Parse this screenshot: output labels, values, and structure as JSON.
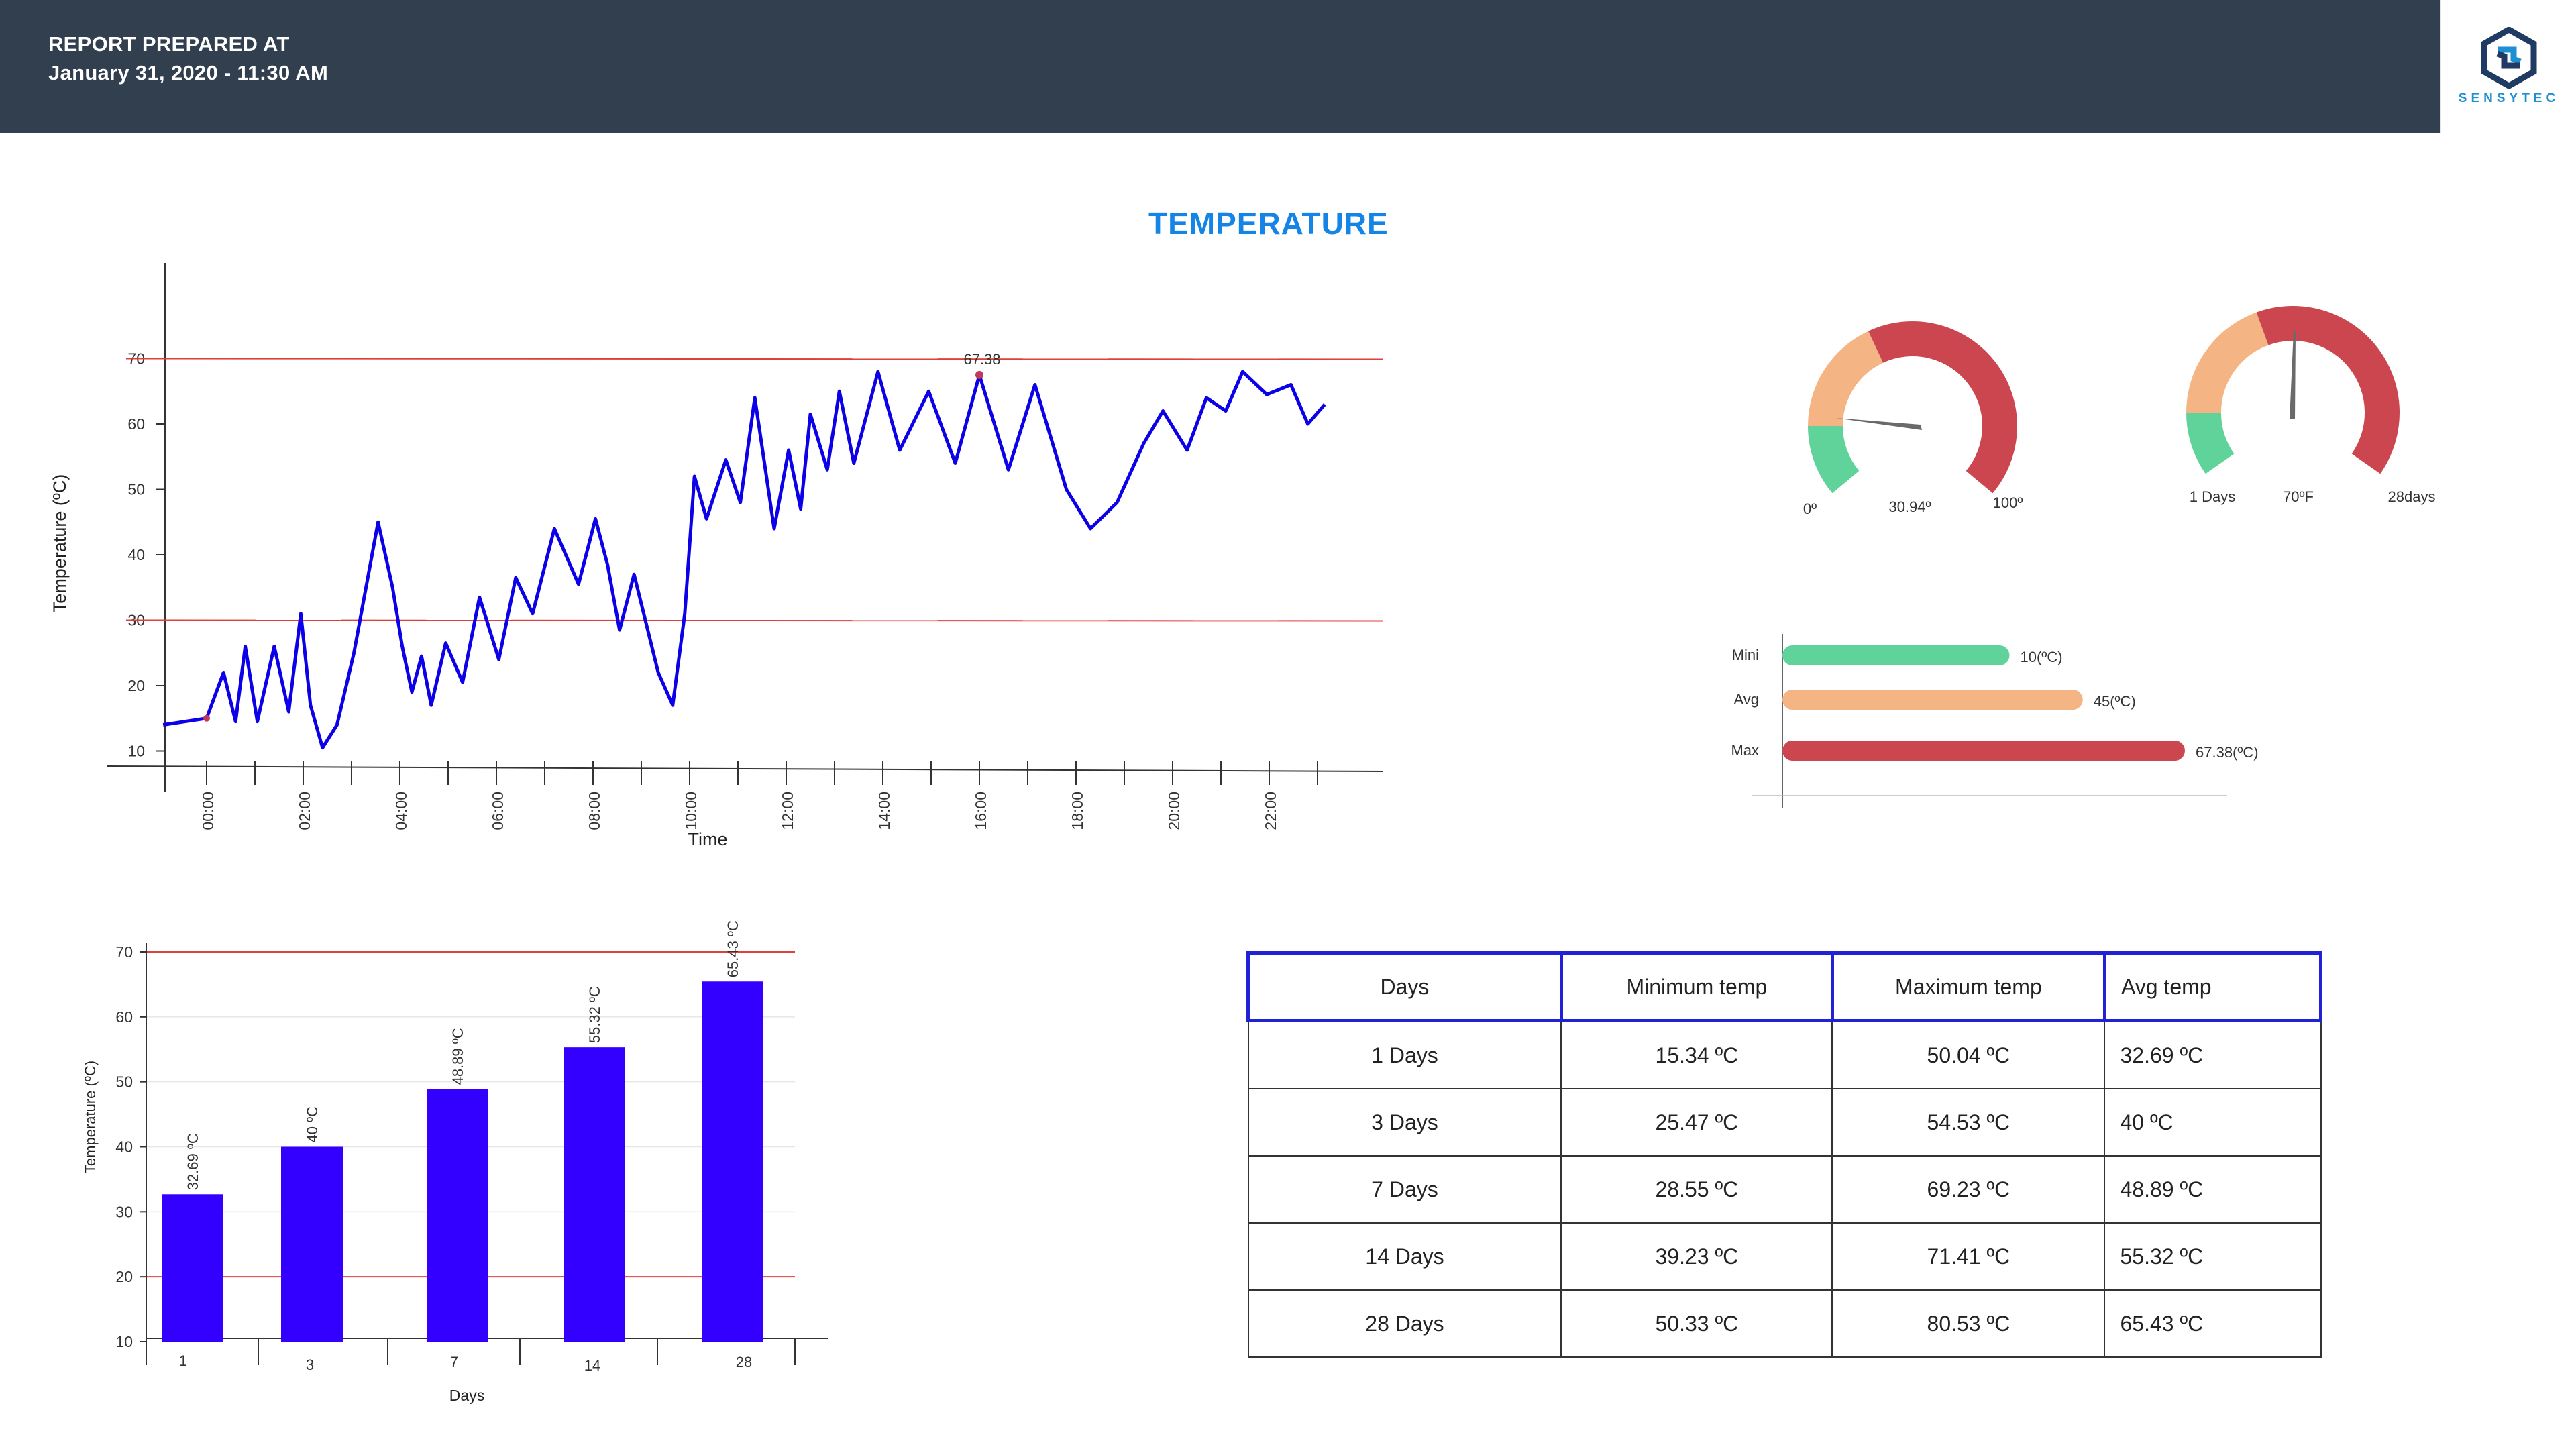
{
  "header": {
    "line1": "REPORT PREPARED AT",
    "line2": "January 31, 2020 - 11:30 AM",
    "logo_text": "SENSYTEC"
  },
  "section_title": "TEMPERATURE",
  "colors": {
    "header_bg": "#323f4e",
    "title": "#1484e6",
    "line": "#0c00e8",
    "bar": "#3300ff",
    "threshold": "#e0403a",
    "green": "#5fd39a",
    "orange": "#f4b484",
    "red": "#cc4650"
  },
  "gauges": {
    "temp": {
      "min_label": "0º",
      "value_label": "30.94º",
      "max_label": "100º",
      "value": 30.94,
      "min": 0,
      "max": 100
    },
    "days": {
      "min_label": "1 Days",
      "value_label": "70ºF",
      "max_label": "28days"
    }
  },
  "summary_bars": [
    {
      "label": "Mini",
      "value": 10,
      "value_label": "10(ºC)",
      "color": "#5fd39a"
    },
    {
      "label": "Avg",
      "value": 45,
      "value_label": "45(ºC)",
      "color": "#f4b484"
    },
    {
      "label": "Max",
      "value": 67.38,
      "value_label": "67.38(ºC)",
      "color": "#cc4650"
    }
  ],
  "chart_data": [
    {
      "type": "line",
      "xlabel": "Time",
      "ylabel": "Temperature (ºC)",
      "ylim": [
        0,
        70
      ],
      "yticks": [
        10,
        20,
        30,
        40,
        50,
        60,
        70
      ],
      "xticks": [
        "00:00",
        "02:00",
        "04:00",
        "06:00",
        "08:00",
        "10:00",
        "12:00",
        "14:00",
        "16:00",
        "18:00",
        "20:00",
        "22:00"
      ],
      "thresholds": [
        30,
        70
      ],
      "max_annotation": "67.38",
      "series": [
        {
          "x": [
            -0.9,
            0,
            0.35,
            0.6,
            0.8,
            1.05,
            1.4,
            1.7,
            1.95,
            2.15,
            2.4,
            2.7,
            3.05,
            3.55,
            3.85,
            4.05,
            4.25,
            4.45,
            4.65,
            4.95,
            5.3,
            5.65,
            6.05,
            6.4,
            6.75,
            7.2,
            7.7,
            8.05,
            8.3,
            8.55,
            8.85,
            9.35,
            9.65,
            9.9,
            10.1,
            10.35,
            10.75,
            11.05,
            11.35,
            11.75,
            12.05,
            12.3,
            12.5,
            12.85,
            13.1,
            13.4,
            13.9,
            14.35,
            14.95,
            15.5,
            16,
            16.6,
            17.15,
            17.8,
            18.3,
            18.85,
            19.4,
            19.8,
            20.3,
            20.7,
            21.1,
            21.45,
            21.95,
            22.45,
            22.8,
            23.15
          ],
          "y": [
            14,
            15,
            22,
            14.5,
            26,
            14.5,
            26,
            16,
            31,
            17,
            10.5,
            14,
            25,
            45,
            35,
            26,
            19,
            24.5,
            17,
            26.5,
            20.5,
            33.5,
            24,
            36.5,
            31,
            44,
            35.5,
            45.5,
            38.5,
            28.5,
            37,
            22,
            17,
            31,
            52,
            45.5,
            54.5,
            48,
            64,
            44,
            56,
            47,
            61.5,
            53,
            65,
            54,
            68,
            56,
            65,
            54,
            67.5,
            53,
            66,
            50,
            44,
            48,
            57,
            62,
            56,
            64,
            62,
            68,
            64.5,
            66,
            60,
            63
          ]
        }
      ]
    },
    {
      "type": "bar",
      "xlabel": "Days",
      "ylabel": "Temperature (ºC)",
      "ylim": [
        10,
        70
      ],
      "yticks": [
        10,
        20,
        30,
        40,
        50,
        60,
        70
      ],
      "thresholds": [
        20,
        70
      ],
      "categories": [
        "1",
        "3",
        "7",
        "14",
        "28"
      ],
      "values": [
        32.69,
        40,
        48.89,
        55.32,
        65.43
      ],
      "value_labels": [
        "32.69 ºC",
        "40 ºC",
        "48.89 ºC",
        "55.32 ºC",
        "65.43 ºC"
      ]
    },
    {
      "type": "table",
      "columns": [
        "Days",
        "Minimum temp",
        "Maximum temp",
        "Avg temp"
      ],
      "rows": [
        [
          "1 Days",
          "15.34 ºC",
          "50.04 ºC",
          "32.69 ºC"
        ],
        [
          "3 Days",
          "25.47 ºC",
          "54.53 ºC",
          "40 ºC"
        ],
        [
          "7 Days",
          "28.55 ºC",
          "69.23 ºC",
          "48.89 ºC"
        ],
        [
          "14 Days",
          "39.23 ºC",
          "71.41 ºC",
          "55.32 ºC"
        ],
        [
          "28 Days",
          "50.33 ºC",
          "80.53 ºC",
          "65.43 ºC"
        ]
      ]
    }
  ]
}
